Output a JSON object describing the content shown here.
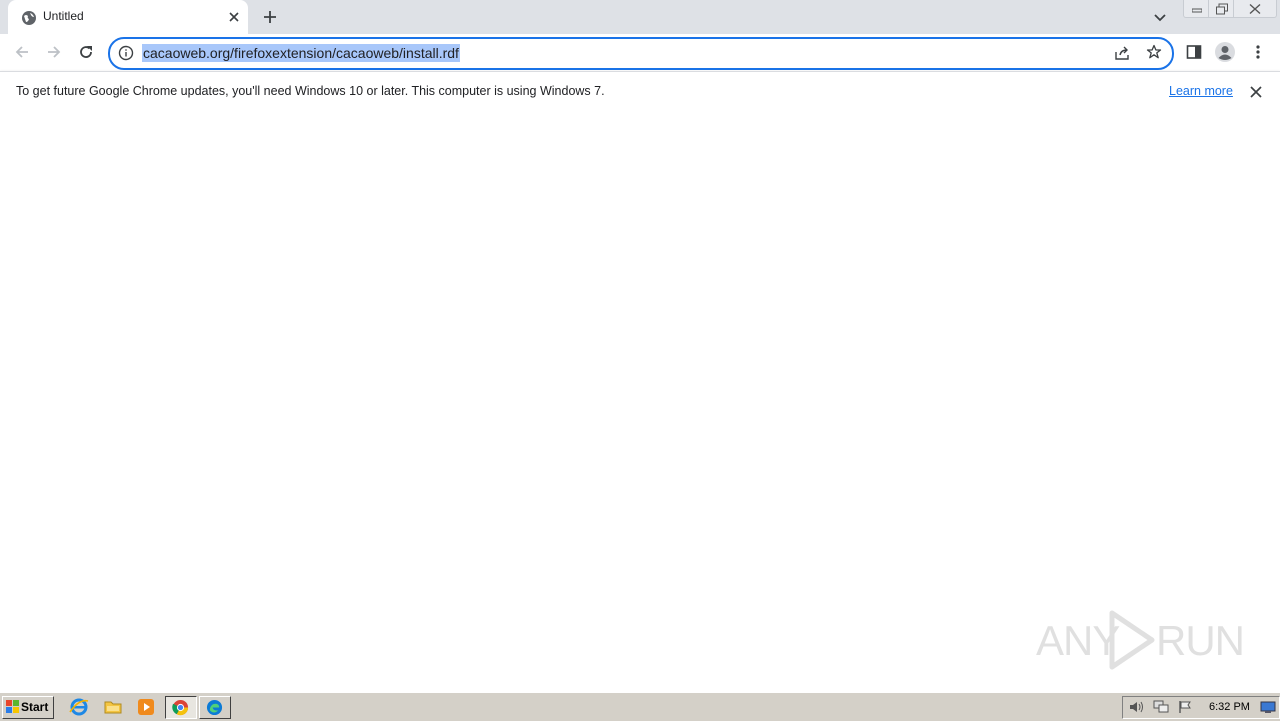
{
  "tab": {
    "title": "Untitled"
  },
  "omnibox": {
    "url": "cacaoweb.org/firefoxextension/cacaoweb/install.rdf"
  },
  "infobar": {
    "message": "To get future Google Chrome updates, you'll need Windows 10 or later. This computer is using Windows 7.",
    "link": "Learn more"
  },
  "watermark": {
    "left": "ANY",
    "right": "RUN"
  },
  "taskbar": {
    "start_label": "Start",
    "clock": "6:32 PM"
  },
  "colors": {
    "accent": "#1a73e8",
    "url_highlight": "#a8c7fa",
    "tabstrip": "#dee1e6",
    "taskbar": "#d4d0c8"
  },
  "icons": [
    "globe-icon",
    "close-icon",
    "plus-icon",
    "chevron-down-icon",
    "minimize-icon",
    "restore-icon",
    "back-arrow-icon",
    "forward-arrow-icon",
    "reload-icon",
    "info-icon",
    "share-icon",
    "star-icon",
    "side-panel-icon",
    "profile-icon",
    "more-vert-icon",
    "windows-logo-icon",
    "ie-icon",
    "folder-icon",
    "media-player-icon",
    "chrome-icon",
    "edge-icon",
    "volume-icon",
    "network-icon",
    "flag-icon",
    "desktop-icon"
  ]
}
